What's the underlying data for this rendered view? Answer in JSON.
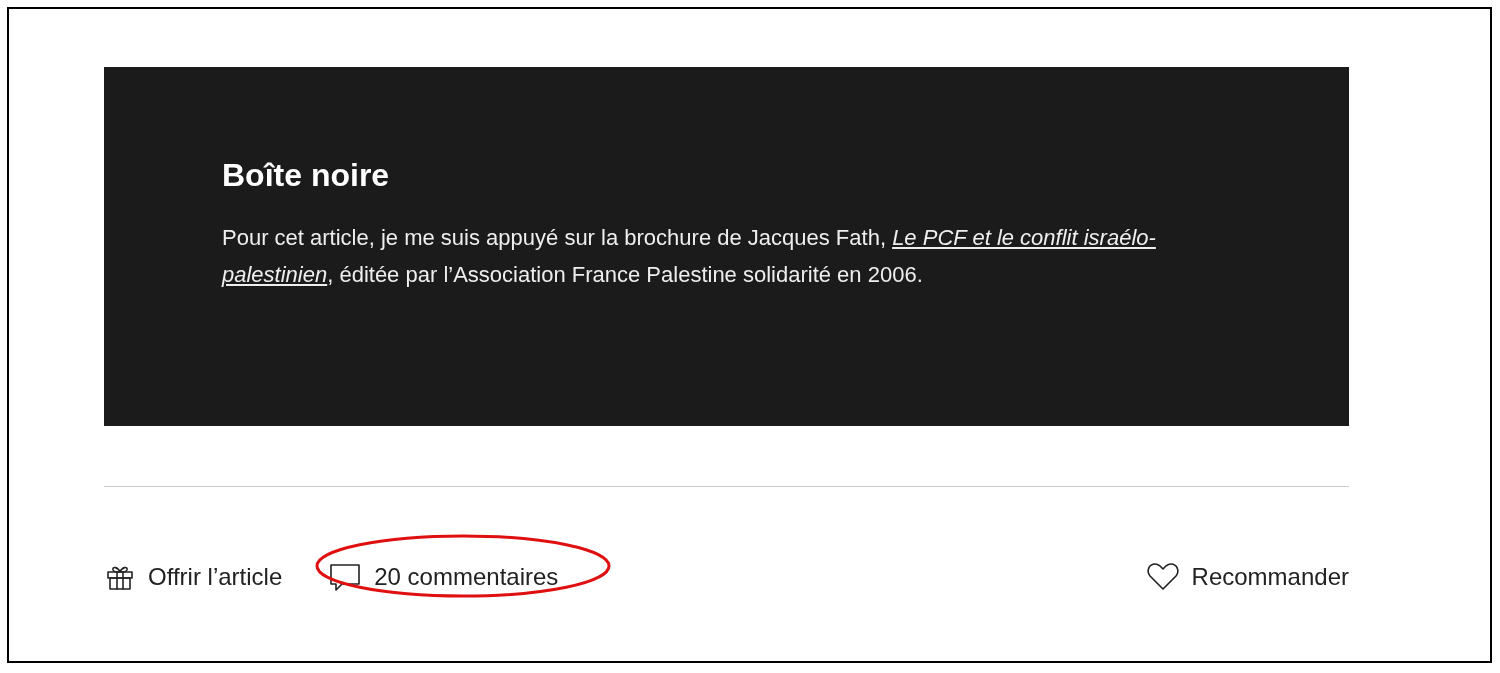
{
  "box": {
    "title": "Boîte noire",
    "text": "Pour cet article, je me suis appuyé sur la brochure de Jacques Fath, *Le PCF et le conflit israélo-palestinien*, éditée par l’Association France Palestine solidarité en 2006."
  },
  "actions": [
    {
      "kind": "gift",
      "label": "Offrir l’article",
      "circled": false
    },
    {
      "kind": "comment",
      "label": "20 commentaires",
      "circled": true
    },
    {
      "kind": "heart",
      "label": "Recommander",
      "circled": false
    }
  ]
}
